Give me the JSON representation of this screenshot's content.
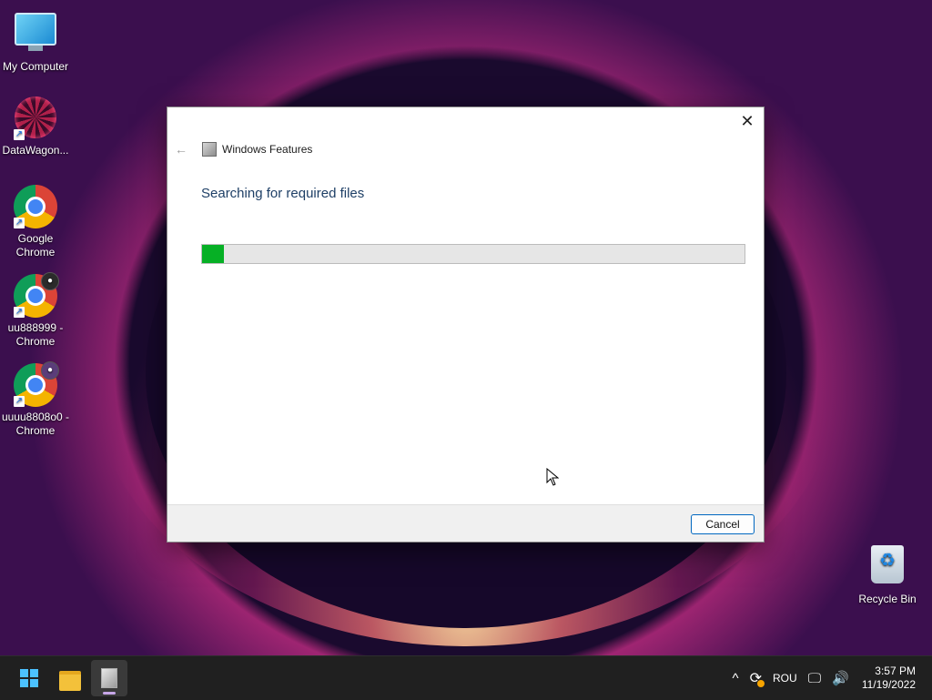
{
  "desktop": {
    "icons": [
      {
        "label": "My Computer"
      },
      {
        "label": "DataWagon..."
      },
      {
        "label": "Google Chrome"
      },
      {
        "label": "uu888999 - Chrome"
      },
      {
        "label": "uuuu8808o0 - Chrome"
      },
      {
        "label": "Recycle Bin"
      }
    ]
  },
  "dialog": {
    "title": "Windows Features",
    "heading": "Searching for required files",
    "progress_percent": 4,
    "cancel_label": "Cancel",
    "close_glyph": "✕",
    "back_glyph": "←"
  },
  "taskbar": {
    "apps": [
      "start-icon",
      "file-explorer-icon",
      "windows-features-icon"
    ],
    "tray": {
      "chevron_glyph": "^",
      "language": "ROU",
      "time": "3:57 PM",
      "date": "11/19/2022"
    }
  },
  "colors": {
    "progress_fill": "#06b025",
    "heading_text": "#1e3f66",
    "accent": "#0067c0"
  }
}
